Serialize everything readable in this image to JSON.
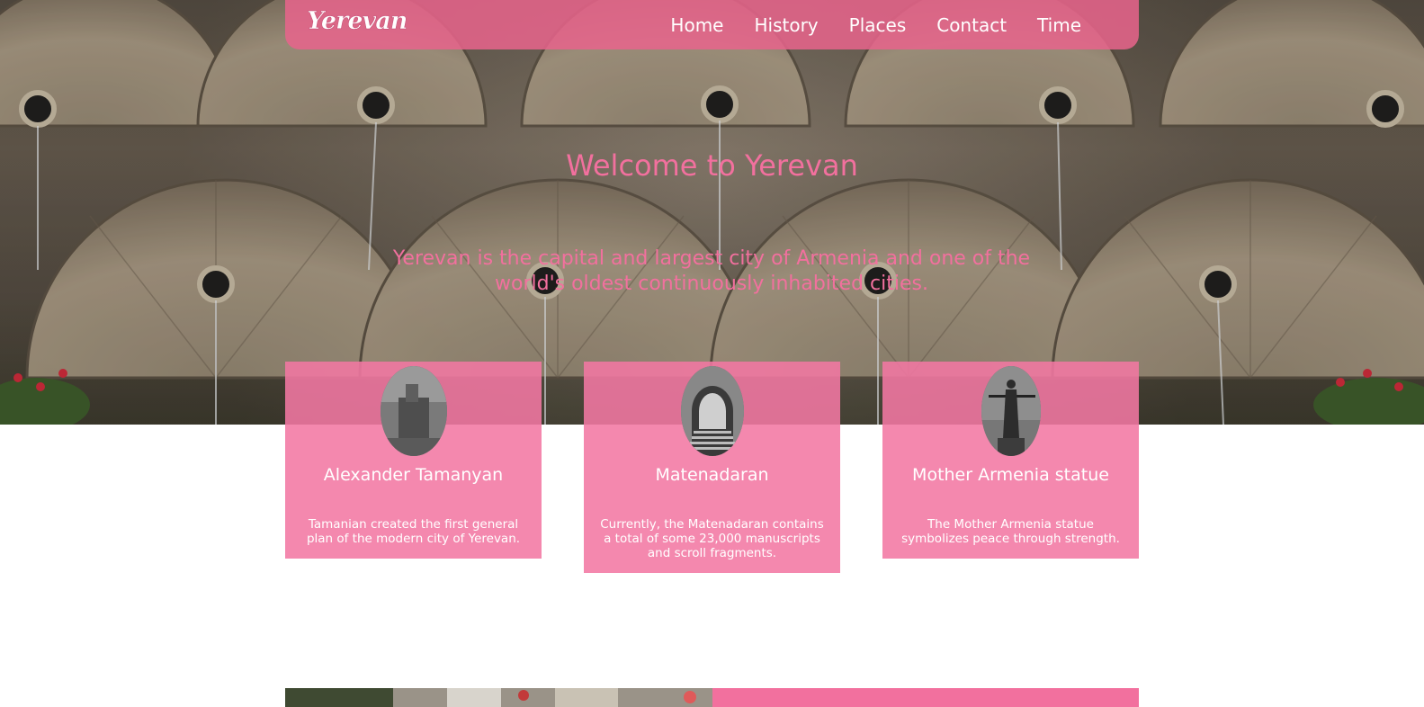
{
  "navbar": {
    "logo": "Yerevan",
    "links": [
      "Home",
      "History",
      "Places",
      "Contact",
      "Time"
    ]
  },
  "hero": {
    "title": "Welcome to Yerevan",
    "subtitle": "Yerevan is the capital and largest city of Armenia and one of the world's oldest continuously inhabited cities."
  },
  "cards": [
    {
      "title": "Alexander Tamanyan",
      "text": "Tamanian created the first general plan of the modern city of Yerevan."
    },
    {
      "title": "Matenadaran",
      "text": "Currently, the Matenadaran contains a total of some 23,000 manuscripts and scroll fragments."
    },
    {
      "title": "Mother Armenia statue",
      "text": "The Mother Armenia statue symbolizes peace through strength."
    }
  ],
  "colors": {
    "accent": "#f2709e",
    "navbar": "#e8648c",
    "card": "#f278a3"
  }
}
